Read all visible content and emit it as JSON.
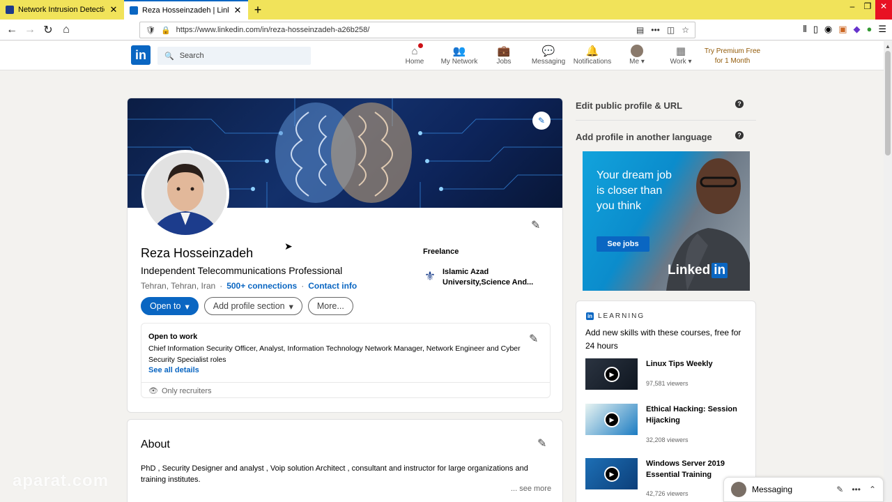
{
  "browser": {
    "tabs": [
      {
        "title": "Network Intrusion Detection | S",
        "active": false,
        "favicon_color": "#1e3a8a"
      },
      {
        "title": "Reza Hosseinzadeh | LinkedIn",
        "active": true,
        "favicon_color": "#0a66c2"
      }
    ],
    "url": "https://www.linkedin.com/in/reza-hosseinzadeh-a26b258/"
  },
  "header": {
    "logo": "in",
    "search_placeholder": "Search",
    "nav": [
      {
        "label": "Home",
        "icon": "home-icon",
        "glyph": "⌂",
        "badge": true
      },
      {
        "label": "My Network",
        "icon": "network-icon",
        "glyph": "👥",
        "badge": false
      },
      {
        "label": "Jobs",
        "icon": "briefcase-icon",
        "glyph": "💼",
        "badge": false
      },
      {
        "label": "Messaging",
        "icon": "chat-icon",
        "glyph": "💬",
        "badge": false
      },
      {
        "label": "Notifications",
        "icon": "bell-icon",
        "glyph": "🔔",
        "badge": false
      },
      {
        "label": "Me",
        "icon": "avatar-icon",
        "glyph": "",
        "badge": false
      },
      {
        "label": "Work",
        "icon": "grid-icon",
        "glyph": "▦",
        "badge": false
      }
    ],
    "premium": "Try Premium Free for 1 Month"
  },
  "profile": {
    "name": "Reza Hosseinzadeh",
    "headline": "Independent Telecommunications Professional",
    "location": "Tehran, Tehran, Iran",
    "connections": "500+ connections",
    "contact": "Contact info",
    "buttons": {
      "open_to": "Open to",
      "add_section": "Add profile section",
      "more": "More..."
    },
    "experience": "Freelance",
    "education": "Islamic Azad University,Science And...",
    "open_to_work": {
      "title": "Open to work",
      "text": "Chief Information Security Officer, Analyst, Information Technology Network Manager, Network Engineer and Cyber Security Specialist roles",
      "link": "See all details",
      "visibility": "Only recruiters"
    }
  },
  "about": {
    "title": "About",
    "text": "PhD , Security Designer and analyst , Voip solution Architect , consultant and instructor for large organizations and training institutes.",
    "see_more": "... see more"
  },
  "rail": {
    "edit_public": "Edit public profile & URL",
    "add_language": "Add profile in another language",
    "ad": {
      "text": "Your dream job is closer than you think",
      "button": "See jobs",
      "logo_word": "Linked",
      "logo_in": "in"
    }
  },
  "learning": {
    "heading": "LEARNING",
    "intro": "Add new skills with these courses, free for 24 hours",
    "courses": [
      {
        "title": "Linux Tips Weekly",
        "views": "97,581 viewers"
      },
      {
        "title": "Ethical Hacking: Session Hijacking",
        "views": "32,208 viewers"
      },
      {
        "title": "Windows Server 2019 Essential Training",
        "views": "42,726 viewers"
      }
    ]
  },
  "messaging": {
    "label": "Messaging"
  },
  "watermark": "aparat.com"
}
